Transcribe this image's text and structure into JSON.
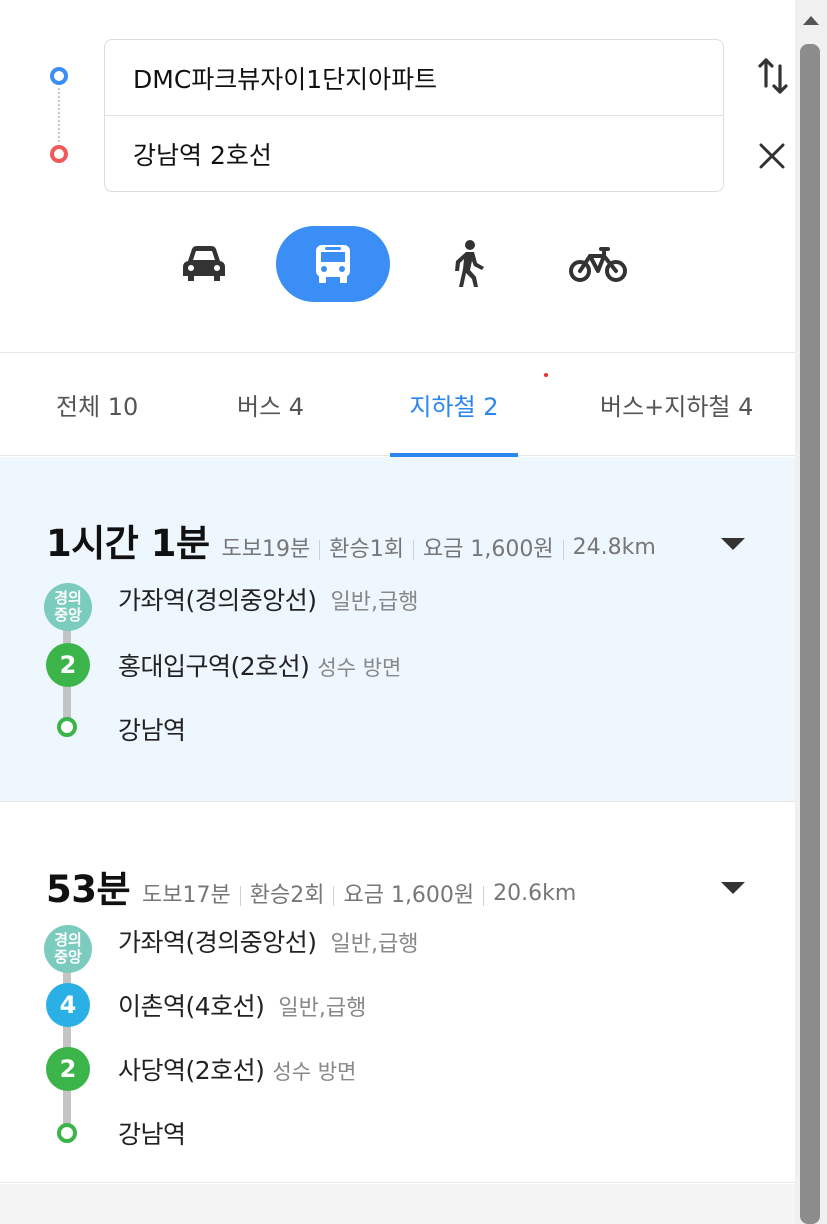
{
  "search": {
    "origin": "DMC파크뷰자이1단지아파트",
    "destination": "강남역 2호선"
  },
  "modes": [
    "car",
    "transit",
    "walk",
    "bike"
  ],
  "active_mode": "transit",
  "tabs": [
    {
      "label": "전체 10"
    },
    {
      "label": "버스 4"
    },
    {
      "label": "지하철 2"
    },
    {
      "label": "버스+지하철 4"
    }
  ],
  "active_tab": "지하철 2",
  "colors": {
    "accent": "#3b8ef5",
    "origin_dot": "#3b8ef5",
    "dest_dot": "#f05a5a",
    "gyeongui_jungang": "#7bcbbe",
    "line2": "#3bb54a",
    "line4": "#2bb0e6",
    "selected_route_bg": "#eef6fe"
  },
  "routes": [
    {
      "duration": "1시간 1분",
      "walk": "도보19분",
      "transfers": "환승1회",
      "fare": "요금 1,600원",
      "distance": "24.8km",
      "stops": [
        {
          "badge": "경의\n중앙",
          "badge_top": "경의",
          "badge_bottom": "중앙",
          "name": "가좌역(경의중앙선)",
          "sub": "일반,급행"
        },
        {
          "badge": "2",
          "name": "홍대입구역(2호선)",
          "sub": "성수 방면"
        },
        {
          "badge": "",
          "name": "강남역",
          "sub": ""
        }
      ]
    },
    {
      "duration": "53분",
      "walk": "도보17분",
      "transfers": "환승2회",
      "fare": "요금 1,600원",
      "distance": "20.6km",
      "stops": [
        {
          "badge_top": "경의",
          "badge_bottom": "중앙",
          "name": "가좌역(경의중앙선)",
          "sub": "일반,급행"
        },
        {
          "badge": "4",
          "name": "이촌역(4호선)",
          "sub": "일반,급행"
        },
        {
          "badge": "2",
          "name": "사당역(2호선)",
          "sub": "성수 방면"
        },
        {
          "badge": "",
          "name": "강남역",
          "sub": ""
        }
      ]
    }
  ]
}
